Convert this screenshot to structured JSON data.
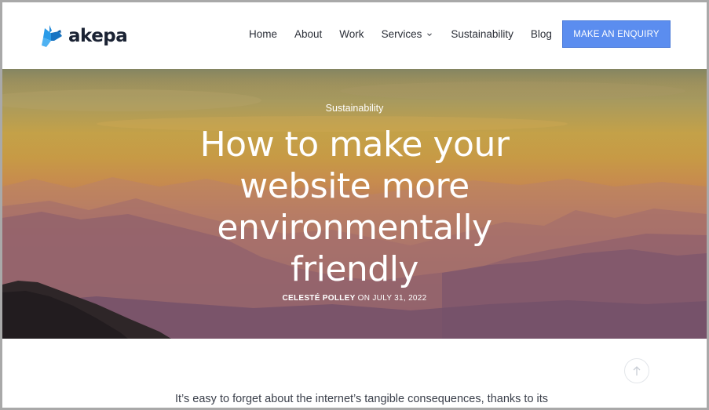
{
  "brand": {
    "name": "akepa",
    "logo_icon": "bird-icon",
    "logo_color": "#1e88d8"
  },
  "nav": {
    "items": [
      {
        "label": "Home"
      },
      {
        "label": "About"
      },
      {
        "label": "Work"
      },
      {
        "label": "Services",
        "has_dropdown": true
      },
      {
        "label": "Sustainability"
      },
      {
        "label": "Blog"
      }
    ],
    "cta_label": "MAKE AN ENQUIRY",
    "cta_color": "#5b8def"
  },
  "hero": {
    "category": "Sustainability",
    "title": "How to make your website more environmentally friendly",
    "author": "CELESTÉ POLLEY",
    "date_prefix": "ON",
    "date": "JULY 31, 2022"
  },
  "article": {
    "intro": "It’s easy to forget about the internet’s tangible consequences, thanks to its"
  },
  "scroll_top": {
    "icon": "arrow-up-icon"
  }
}
